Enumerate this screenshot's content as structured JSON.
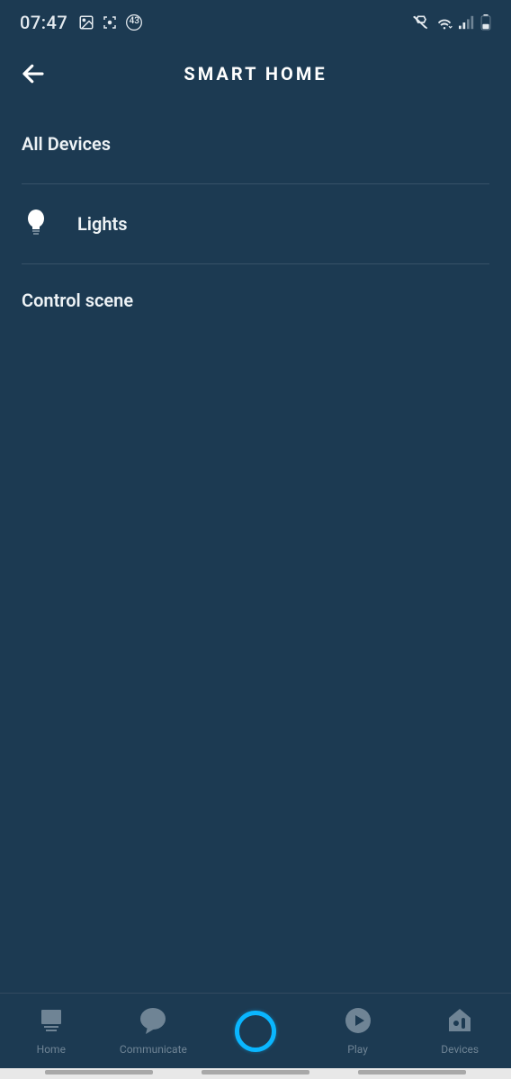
{
  "status": {
    "time": "07:47",
    "badge_count": "43"
  },
  "header": {
    "title": "SMART HOME"
  },
  "sections": {
    "all_devices": "All Devices",
    "control_scene": "Control scene"
  },
  "devices": [
    {
      "label": "Lights"
    }
  ],
  "nav": {
    "home": "Home",
    "communicate": "Communicate",
    "play": "Play",
    "devices": "Devices"
  }
}
